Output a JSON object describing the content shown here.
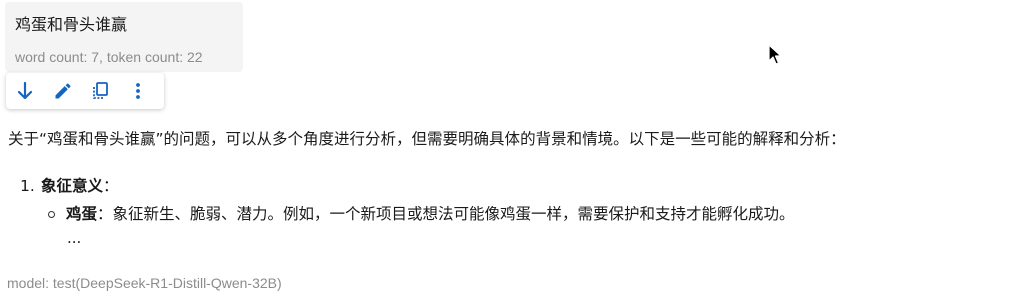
{
  "user_message": {
    "text": "鸡蛋和骨头谁赢",
    "meta": "word count: 7, token count: 22"
  },
  "toolbar": {
    "icons": [
      "download-icon",
      "edit-icon",
      "copy-icon",
      "more-vert-icon"
    ],
    "accent_color": "#1565c0"
  },
  "answer": {
    "intro": "关于“鸡蛋和骨头谁赢”的问题，可以从多个角度进行分析，但需要明确具体的背景和情境。以下是一些可能的解释和分析：",
    "list": [
      {
        "number": "1.",
        "title": "象征意义",
        "suffix": "：",
        "sub_items": [
          {
            "title": "鸡蛋",
            "text": "：象征新生、脆弱、潜力。例如，一个新项目或想法可能像鸡蛋一样，需要保护和支持才能孵化成功。"
          }
        ]
      }
    ],
    "ellipsis": "..."
  },
  "model_line": "model: test(DeepSeek-R1-Distill-Qwen-32B)"
}
